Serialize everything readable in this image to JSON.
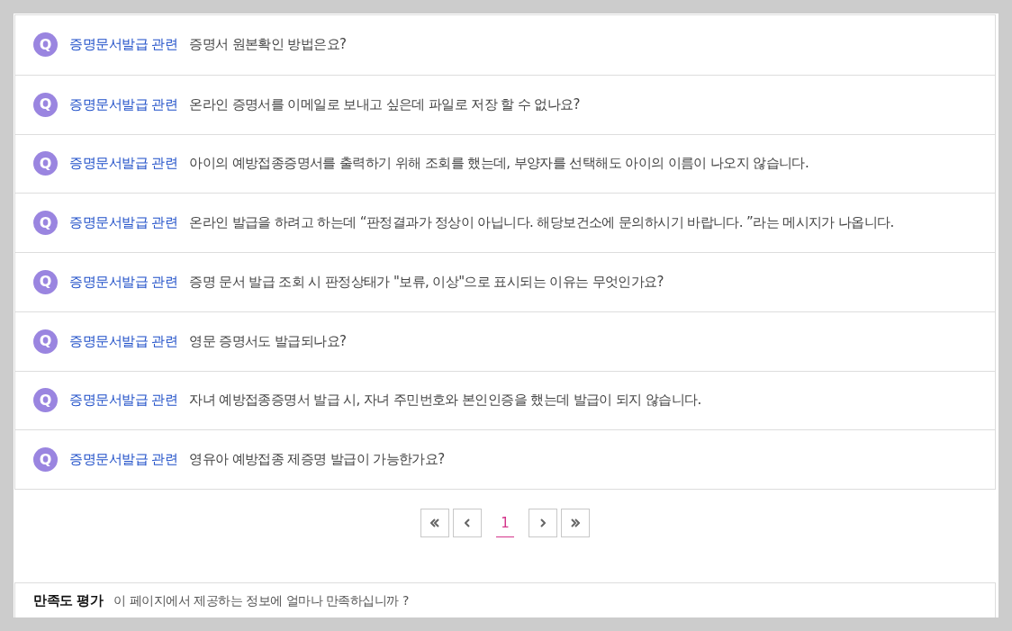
{
  "faq": {
    "items": [
      {
        "badge": "Q",
        "category": "증명문서발급 관련",
        "question": "증명서 원본확인 방법은요?"
      },
      {
        "badge": "Q",
        "category": "증명문서발급 관련",
        "question": "온라인 증명서를 이메일로 보내고 싶은데 파일로 저장 할 수 없나요?"
      },
      {
        "badge": "Q",
        "category": "증명문서발급 관련",
        "question": "아이의 예방접종증명서를 출력하기 위해 조회를 했는데, 부양자를 선택해도 아이의 이름이 나오지 않습니다."
      },
      {
        "badge": "Q",
        "category": "증명문서발급 관련",
        "question": "온라인 발급을 하려고 하는데 “판정결과가 정상이 아닙니다. 해당보건소에 문의하시기 바랍니다. ”라는 메시지가 나옵니다."
      },
      {
        "badge": "Q",
        "category": "증명문서발급 관련",
        "question": "증명 문서 발급 조회 시 판정상태가 \"보류, 이상\"으로 표시되는 이유는 무엇인가요?"
      },
      {
        "badge": "Q",
        "category": "증명문서발급 관련",
        "question": "영문 증명서도 발급되나요?"
      },
      {
        "badge": "Q",
        "category": "증명문서발급 관련",
        "question": "자녀 예방접종증명서 발급 시, 자녀 주민번호와 본인인증을 했는데 발급이 되지 않습니다."
      },
      {
        "badge": "Q",
        "category": "증명문서발급 관련",
        "question": "영유아 예방접종 제증명 발급이 가능한가요?"
      }
    ]
  },
  "pagination": {
    "pages": [
      {
        "label": "1",
        "selected": true
      }
    ]
  },
  "satisfaction": {
    "title": "만족도 평가",
    "question": "이 페이지에서 제공하는 정보에 얼마나 만족하십니까 ?"
  }
}
